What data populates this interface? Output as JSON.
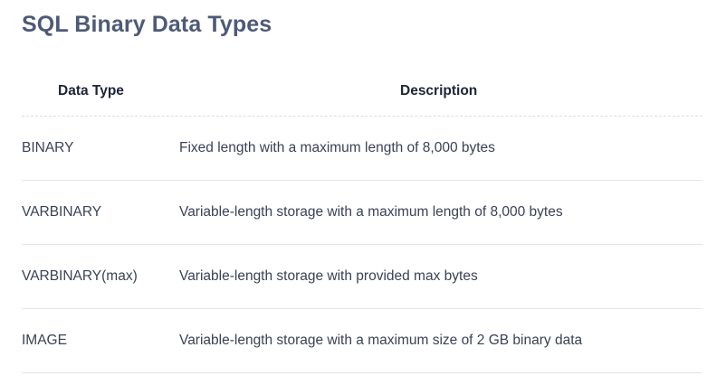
{
  "page": {
    "title": "SQL Binary Data Types"
  },
  "table": {
    "headers": {
      "type": "Data Type",
      "description": "Description"
    },
    "rows": [
      {
        "type": "BINARY",
        "description": "Fixed length with a maximum length of 8,000 bytes"
      },
      {
        "type": "VARBINARY",
        "description": "Variable-length storage with a maximum length of 8,000 bytes"
      },
      {
        "type": "VARBINARY(max)",
        "description": "Variable-length storage with provided max bytes"
      },
      {
        "type": "IMAGE",
        "description": "Variable-length storage with a maximum size of 2 GB binary data"
      }
    ]
  }
}
